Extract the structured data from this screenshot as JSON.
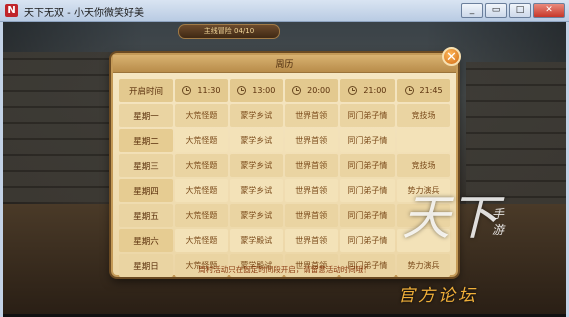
{
  "window": {
    "title": "天下无双 - 小天你微笑好美",
    "icon_letter": "N",
    "buttons": {
      "minimize": "_",
      "restore": "▭",
      "maximize": "□",
      "close": "✕"
    }
  },
  "hud": {
    "quest": "主线冒险 04/10"
  },
  "panel": {
    "title": "周历",
    "close_symbol": "✕",
    "header_label": "开启时间",
    "times": [
      "11:30",
      "13:00",
      "20:00",
      "21:00",
      "21:45"
    ],
    "rows": [
      {
        "day": "星期一",
        "events": [
          "大荒怪题",
          "蒙学乡试",
          "世界首领",
          "同门弟子情",
          "竞技场"
        ]
      },
      {
        "day": "星期二",
        "events": [
          "大荒怪题",
          "蒙学乡试",
          "世界首领",
          "同门弟子情",
          ""
        ]
      },
      {
        "day": "星期三",
        "events": [
          "大荒怪题",
          "蒙学乡试",
          "世界首领",
          "同门弟子情",
          "竞技场"
        ]
      },
      {
        "day": "星期四",
        "events": [
          "大荒怪题",
          "蒙学乡试",
          "世界首领",
          "同门弟子情",
          "势力演兵"
        ]
      },
      {
        "day": "星期五",
        "events": [
          "大荒怪题",
          "蒙学乡试",
          "世界首领",
          "同门弟子情",
          ""
        ]
      },
      {
        "day": "星期六",
        "events": [
          "大荒怪题",
          "蒙学殿试",
          "世界首领",
          "同门弟子情",
          ""
        ]
      },
      {
        "day": "星期日",
        "events": [
          "大荒怪题",
          "蒙学殿试",
          "世界首领",
          "同门弟子情",
          "势力演兵"
        ]
      }
    ],
    "footnote": "周村活动只在固定时间段开启，请留意活动时间哦！"
  },
  "watermark": {
    "big": "天下",
    "side": "手游",
    "forum": "官方论坛"
  },
  "colors": {
    "panel_bg": "#f6e7c4",
    "text": "#7a4a1a",
    "accent": "#d06a14"
  }
}
